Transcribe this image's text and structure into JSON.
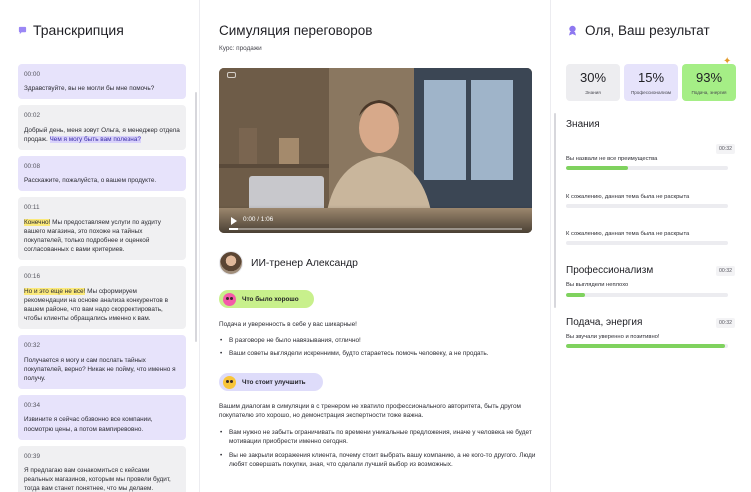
{
  "transcript": {
    "title": "Транскрипция",
    "messages": [
      {
        "time": "00:00",
        "role": "client",
        "text": "Здравствуйте, вы не могли бы мне помочь?"
      },
      {
        "time": "00:02",
        "role": "user",
        "text_a": "Добрый день, меня зовут Ольга, я менеджер отдела продаж.",
        "hl": "Чем я могу быть вам полезна?",
        "text_b": ""
      },
      {
        "time": "00:08",
        "role": "client",
        "text": "Расскажите, пожалуйста, о вашем продукте."
      },
      {
        "time": "00:11",
        "role": "user",
        "hl": "Конечно!",
        "text_b": "Мы предоставляем услуги по аудиту вашего магазина, это похоже на тайных покупателей, только подробнее и оценкой согласованных с вами критериев."
      },
      {
        "time": "00:16",
        "role": "user",
        "hl": "Но и это еще не все!",
        "text_b": "Мы сформируем рекомендации на основе анализа конкурентов в вашем районе, что вам надо скорректировать, чтобы клиенты обращались именно к вам."
      },
      {
        "time": "00:32",
        "role": "client",
        "text": "Получается я могу и сам послать тайных покупателей, верно? Никак не пойму, что именно я получу."
      },
      {
        "time": "00:34",
        "role": "client",
        "text": "Извините я сейчас обзвонно все компании, посмотрю цены, а потом вампиревовно."
      },
      {
        "time": "00:39",
        "role": "user",
        "text": "Я предлагаю вам ознакомиться с кейсами реальных магазинов, которым мы провели будит, тогда вам станет понятнее, что мы делаем."
      }
    ]
  },
  "center": {
    "title": "Симуляция переговоров",
    "course": "Курс: продажи",
    "video": {
      "time": "0:00 / 1:06",
      "progress": 0.03
    },
    "coach_name": "ИИ-тренер Александр",
    "good_label": "Что было хорошо",
    "good_intro": "Подача и уверенность в себе у вас шикарные!",
    "good_bullets": [
      "В разговоре не было навязывания, отлично!",
      "Ваши советы выглядели искренними, будто стараетесь помочь человеку, а не продать."
    ],
    "improve_label": "Что стоит улучшить",
    "improve_intro": "Вашим диалогам в симуляции в с тренером не хватило профессионального авторитета, быть другом покупателю это хорошо, но демонстрация экспертности тоже важна.",
    "improve_bullets": [
      "Вам нужно не забыть ограничивать по времени уникальные предложения, иначе у человека не будет мотивации приобрести именно сегодня.",
      "Вы не закрыли возражения клиента, почему стоит выбрать вашу компанию, а не кого-то другого. Люди любят совершать покупки, зная, что сделали лучший выбор из возможных."
    ]
  },
  "results": {
    "title": "Оля, Ваш результат",
    "cards": [
      {
        "value": "30%",
        "label": "Знания"
      },
      {
        "value": "15%",
        "label": "Профессионализм"
      },
      {
        "value": "93%",
        "label": "Подача, энергия"
      }
    ],
    "sections": [
      {
        "title": "Знания",
        "badge": "00:32",
        "items": [
          {
            "text": "Вы назвали не все преимущества",
            "badge": "00:32",
            "level": 0.38
          },
          {
            "text": "К сожалению, данная тема была не раскрыта",
            "level": 0
          },
          {
            "text": "К сожалению, данная тема была не раскрыта",
            "level": 0
          }
        ]
      },
      {
        "title": "Профессионализм",
        "badge": "00:32",
        "items": [
          {
            "text": "Вы выглядели неплохо",
            "level": 0.12
          }
        ]
      },
      {
        "title": "Подача, энергия",
        "badge": "00:32",
        "items": [
          {
            "text": "Вы звучали уверенно и позитивно!",
            "level": 0.98
          }
        ]
      }
    ],
    "accent": "#7fd25e"
  }
}
